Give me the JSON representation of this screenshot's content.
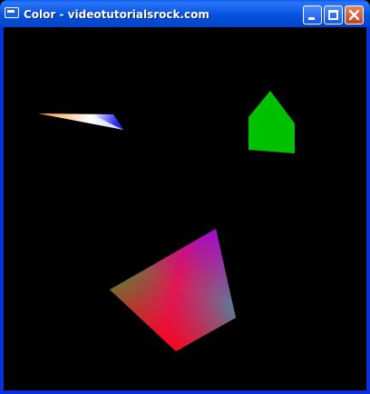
{
  "window": {
    "title": "Color - videotutorialsrock.com",
    "app_icon": "window-app-icon",
    "controls": {
      "minimize_icon": "minimize-icon",
      "maximize_icon": "maximize-icon",
      "close_icon": "close-icon"
    },
    "colors": {
      "titlebar": "#0453e0",
      "frame": "#0831d9",
      "close_button": "#c8401e",
      "canvas_background": "#000000"
    }
  },
  "scene": {
    "shapes": [
      {
        "name": "gradient-sliver-triangle",
        "colors": [
          "#f29a23",
          "#ffffff",
          "#1111ee"
        ]
      },
      {
        "name": "green-pentagon",
        "colors": [
          "#00c000"
        ]
      },
      {
        "name": "rgb-gradient-quad",
        "colors": [
          "#00e000",
          "#ff0020",
          "#a000e0",
          "#20b0b0"
        ]
      }
    ]
  }
}
